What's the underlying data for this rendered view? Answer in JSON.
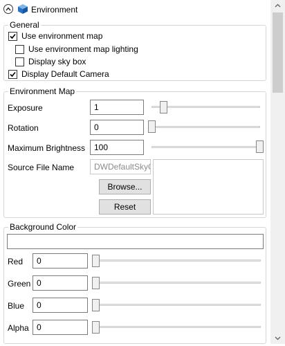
{
  "header": {
    "title": "Environment",
    "collapse_icon": "chevron-up-icon",
    "panel_icon": "cube-icon"
  },
  "general": {
    "title": "General",
    "use_env_map": {
      "label": "Use environment map",
      "checked": true
    },
    "use_env_map_lighting": {
      "label": "Use environment map lighting",
      "checked": false
    },
    "display_sky_box": {
      "label": "Display sky box",
      "checked": false
    },
    "display_default_camera": {
      "label": "Display Default Camera",
      "checked": true
    }
  },
  "environment_map": {
    "title": "Environment Map",
    "exposure": {
      "label": "Exposure",
      "value": "1",
      "slider_level": 0.08
    },
    "rotation": {
      "label": "Rotation",
      "value": "0",
      "slider_level": 0.0
    },
    "max_brightness": {
      "label": "Maximum Brightness",
      "value": "100",
      "slider_level": 1.0
    },
    "source_file": {
      "label": "Source File Name",
      "value": "DWDefaultSkyCube"
    },
    "browse_label": "Browse...",
    "reset_label": "Reset"
  },
  "background_color": {
    "title": "Background Color",
    "red": {
      "label": "Red",
      "value": "0",
      "slider_level": 0.0
    },
    "green": {
      "label": "Green",
      "value": "0",
      "slider_level": 0.0
    },
    "blue": {
      "label": "Blue",
      "value": "0",
      "slider_level": 0.0
    },
    "alpha": {
      "label": "Alpha",
      "value": "0",
      "slider_level": 0.0
    }
  },
  "colors": {
    "accent_blue": "#1f6fc5",
    "check": "#000000"
  }
}
